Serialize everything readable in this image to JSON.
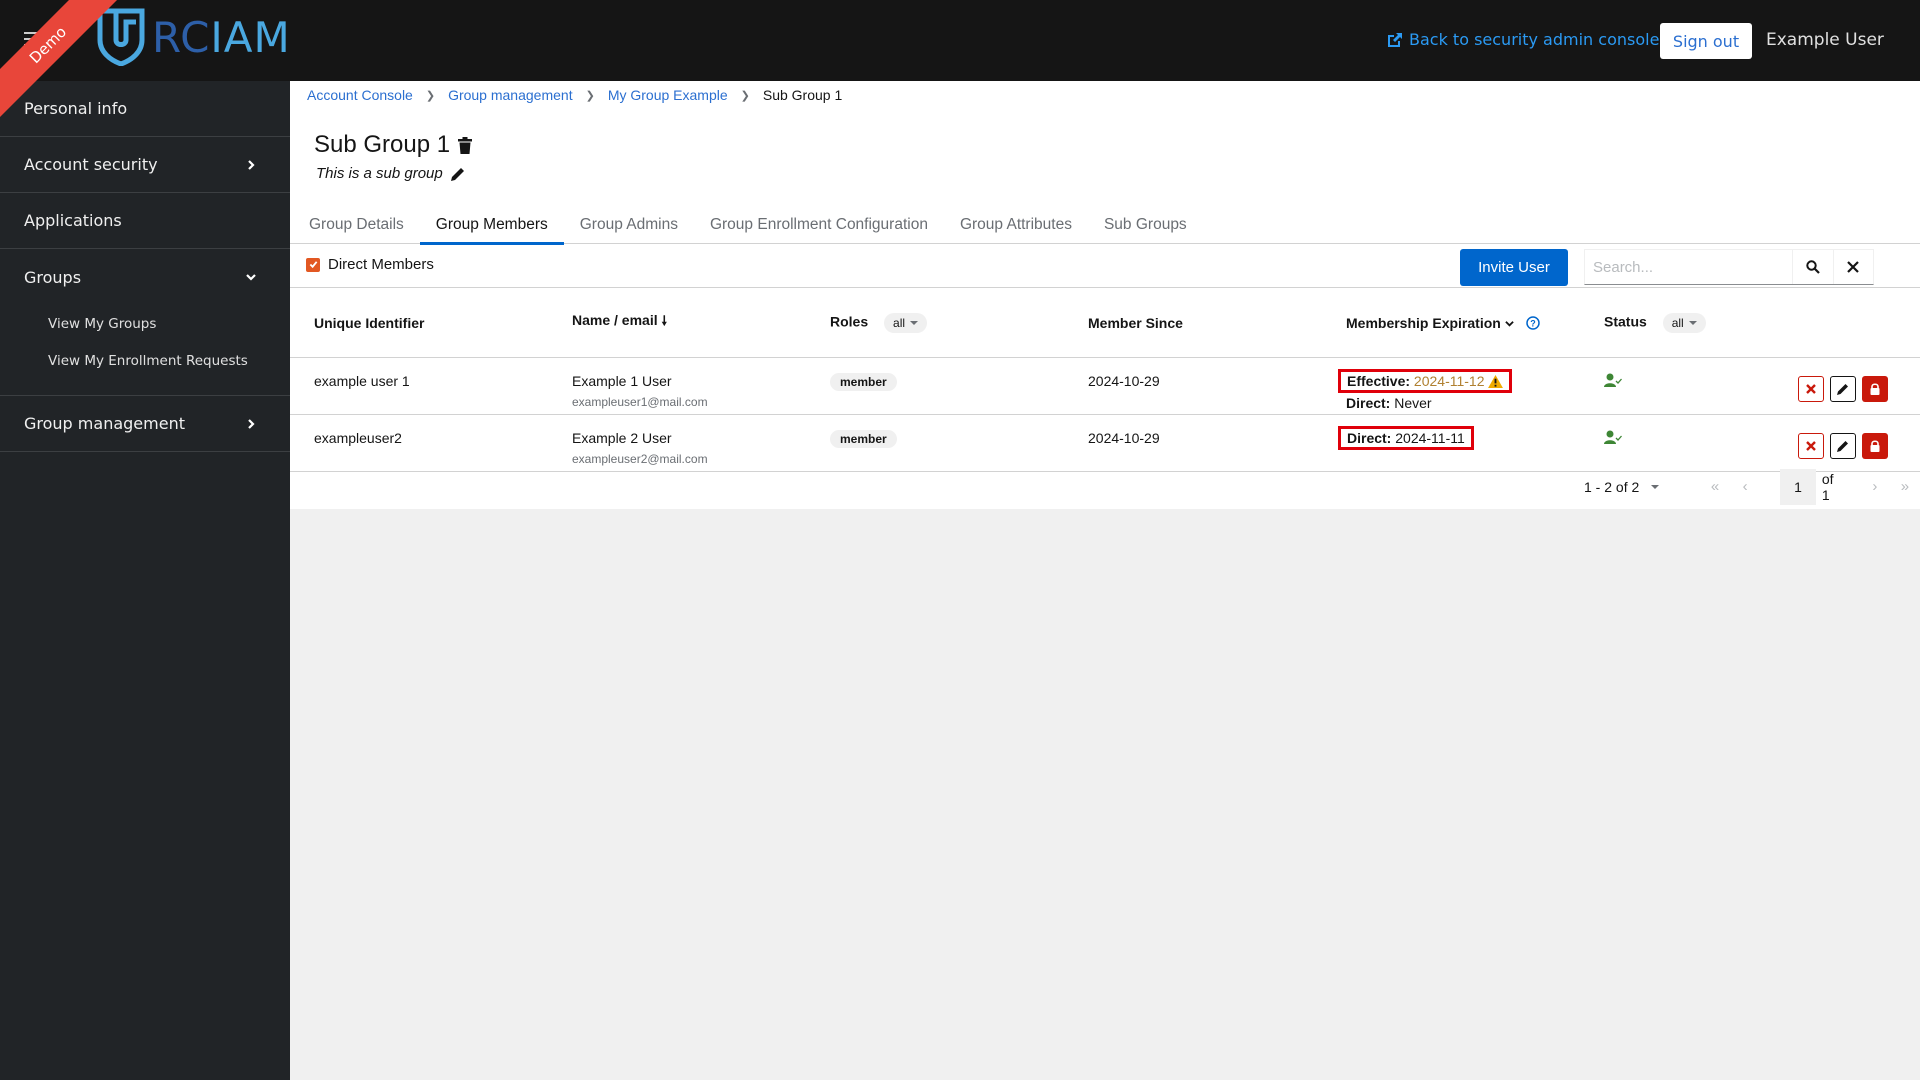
{
  "header": {
    "brand_rc": "RC",
    "brand_iam": "IAM",
    "ribbon": "Demo",
    "back_link": "Back to security admin console",
    "sign_out": "Sign out",
    "user_name": "Example User"
  },
  "sidebar": {
    "items": [
      {
        "label": "Personal info"
      },
      {
        "label": "Account security",
        "icon": "chevron-right"
      },
      {
        "label": "Applications"
      },
      {
        "label": "Groups",
        "icon": "chevron-down",
        "children": [
          {
            "label": "View My Groups"
          },
          {
            "label": "View My Enrollment Requests"
          }
        ]
      },
      {
        "label": "Group management",
        "icon": "chevron-right"
      }
    ]
  },
  "breadcrumb": [
    {
      "label": "Account Console"
    },
    {
      "label": "Group management"
    },
    {
      "label": "My Group Example"
    },
    {
      "label": "Sub Group 1"
    }
  ],
  "page": {
    "title": "Sub Group 1",
    "description": "This is a sub group"
  },
  "tabs": [
    {
      "label": "Group Details"
    },
    {
      "label": "Group Members",
      "active": true
    },
    {
      "label": "Group Admins"
    },
    {
      "label": "Group Enrollment Configuration"
    },
    {
      "label": "Group Attributes"
    },
    {
      "label": "Sub Groups"
    }
  ],
  "toolbar": {
    "direct_members_label": "Direct Members",
    "direct_members_checked": true,
    "invite_label": "Invite User",
    "search_placeholder": "Search...",
    "search_value": ""
  },
  "table": {
    "columns": {
      "uid": "Unique Identifier",
      "name": "Name / email",
      "roles": "Roles",
      "roles_filter": "all",
      "member_since": "Member Since",
      "expiration": "Membership Expiration",
      "status": "Status",
      "status_filter": "all"
    },
    "rows": [
      {
        "uid": "example user 1",
        "name": "Example 1 User",
        "email": "exampleuser1@mail.com",
        "role": "member",
        "member_since": "2024-10-29",
        "effective_label": "Effective:",
        "effective_value": "2024-11-12",
        "direct_label": "Direct:",
        "direct_value": "Never",
        "status": "active"
      },
      {
        "uid": "exampleuser2",
        "name": "Example 2 User",
        "email": "exampleuser2@mail.com",
        "role": "member",
        "member_since": "2024-10-29",
        "direct_label": "Direct:",
        "direct_value": "2024-11-11",
        "status": "active"
      }
    ]
  },
  "pagination": {
    "range": "1 - 2 of 2",
    "current_page": "1",
    "of_pages": "of 1"
  },
  "colors": {
    "accent": "#0066cc",
    "danger": "#c9190b",
    "checkbox": "#e25822",
    "ribbon": "#e8463a",
    "status_ok": "#3e8635",
    "warning": "#f0ab00"
  }
}
